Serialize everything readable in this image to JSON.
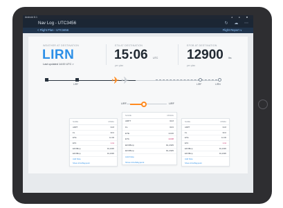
{
  "status_bar": {
    "left_text": "Android 8.1",
    "right_icons": "◂ ● ■"
  },
  "app": {
    "title": "Nav Log - UTC3456",
    "icons": [
      "refresh-icon",
      "cloud-icon",
      "more-icon"
    ]
  },
  "nav": {
    "back_label": "< Flight Plan - UTC3456",
    "right_label": "Flight Report ∨"
  },
  "weather": {
    "label": "WEATHER AT DESTINATION",
    "airport": "LIRN",
    "last_updated": "Last updated 14:00 UTC   >"
  },
  "eta": {
    "label": "ETA AT DESTINATION",
    "time": "15:06",
    "unit": "UTC",
    "sub": "per plan"
  },
  "efob": {
    "label": "EFOB AT DESTINATION",
    "value": "12900",
    "unit": "lbs",
    "sub": "per plan"
  },
  "route": {
    "waypoints": [
      "LIRF",
      "LIRF",
      "LIRN"
    ],
    "progress": 0.45
  },
  "slider": {
    "left_label": "LIRF",
    "right_label": "LIRF",
    "value": 0.3
  },
  "colors": {
    "accent": "#2c8fe7",
    "plane": "#ff8a1f",
    "highlight": "#c2185b"
  },
  "cards": [
    {
      "header": [
        "NAME",
        "MNMA"
      ],
      "rows": [
        [
          "ARPT",
          "34.8"
        ],
        [
          "FL",
          "30.6"
        ],
        [
          "ETE",
          "14.00"
        ],
        [
          "ETA",
          "1.11"
        ],
        [
          "EFOBmp",
          "91,2345"
        ],
        [
          "EFOBmp",
          "91,2345"
        ]
      ],
      "links": [
        "Add Note",
        "Show Info/Waypoint"
      ]
    },
    {
      "header": [
        "NAME",
        "MNMA"
      ],
      "rows": [
        [
          "ARPT",
          "34.8"
        ],
        [
          "FL",
          "30.6"
        ],
        [
          "ETE",
          "14.00"
        ],
        [
          "ETA",
          "14:28"
        ],
        [
          "EFOBmp",
          "91,2345"
        ],
        [
          "EFOBmp",
          "91,2345"
        ]
      ],
      "links": [
        "Add Note",
        "Show Info/Waypoint"
      ]
    },
    {
      "header": [
        "NAME",
        "MNMA"
      ],
      "rows": [
        [
          "ARPT",
          "34.8"
        ],
        [
          "FL",
          "30.6"
        ],
        [
          "ETE",
          "14.00"
        ],
        [
          "ETA",
          "1.11"
        ],
        [
          "EFOBmp",
          "91,2345"
        ],
        [
          "EFOBmp",
          "91,2345"
        ]
      ],
      "links": [
        "Add Note",
        "Show Info/Waypoint"
      ]
    }
  ]
}
